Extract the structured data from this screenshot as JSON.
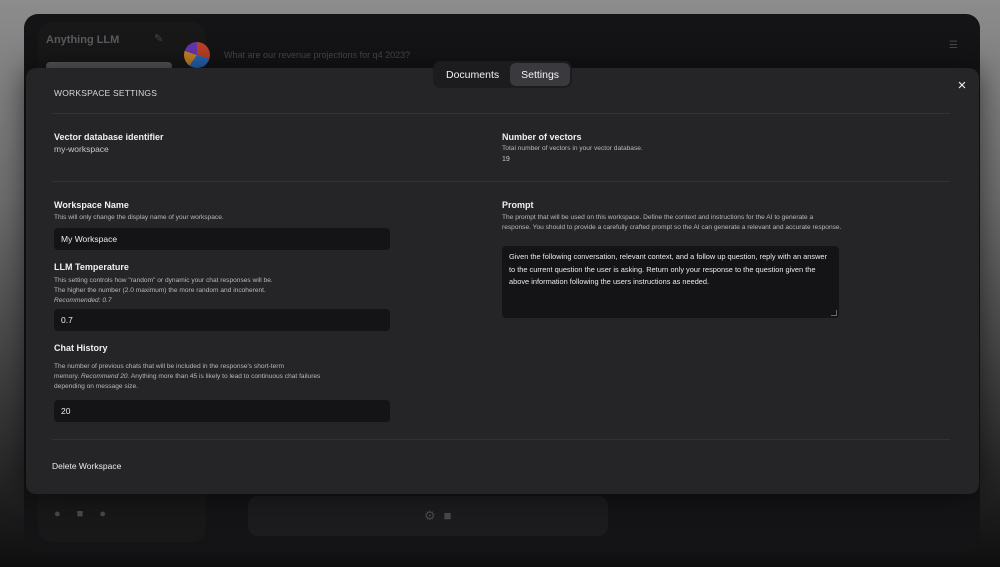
{
  "background": {
    "brand": "Anything LLM",
    "query": "What are our revenue projections for q4 2023?"
  },
  "tabs": [
    {
      "label": "Documents",
      "active": false
    },
    {
      "label": "Settings",
      "active": true
    }
  ],
  "modal": {
    "title": "WORKSPACE SETTINGS",
    "close_icon": "×",
    "vector_db": {
      "label": "Vector database identifier",
      "value": "my-workspace"
    },
    "num_vectors": {
      "label": "Number of vectors",
      "description": "Total number of vectors in your vector database.",
      "value": "19"
    },
    "workspace_name": {
      "label": "Workspace Name",
      "description": "This will only change the display name of your workspace.",
      "value": "My Workspace"
    },
    "llm_temperature": {
      "label": "LLM Temperature",
      "description_line1": "This setting controls how \"random\" or dynamic your chat responses will be.",
      "description_line2": "The higher the number (2.0 maximum) the more random and incoherent.",
      "recommended": "Recommended: 0.7",
      "value": "0.7"
    },
    "chat_history": {
      "label": "Chat History",
      "description_line1": "The number of previous chats that will be included in the response's short-term",
      "description_line2_prefix": "memory.",
      "recommend": "Recommend 20.",
      "description_line2_suffix": "Anything more than 45 is likely to lead to continuous chat failures",
      "description_line3": "depending on message size.",
      "value": "20"
    },
    "prompt": {
      "label": "Prompt",
      "description": "The prompt that will be used on this workspace. Define the context and instructions for the AI to generate a response. You should to provide a carefully crafted prompt so the AI can generate a relevant and accurate response.",
      "value": "Given the following conversation, relevant context, and a follow up question, reply with an answer to the current question the user is asking. Return only your response to the question given the above information following the users instructions as needed."
    },
    "delete_label": "Delete Workspace"
  }
}
